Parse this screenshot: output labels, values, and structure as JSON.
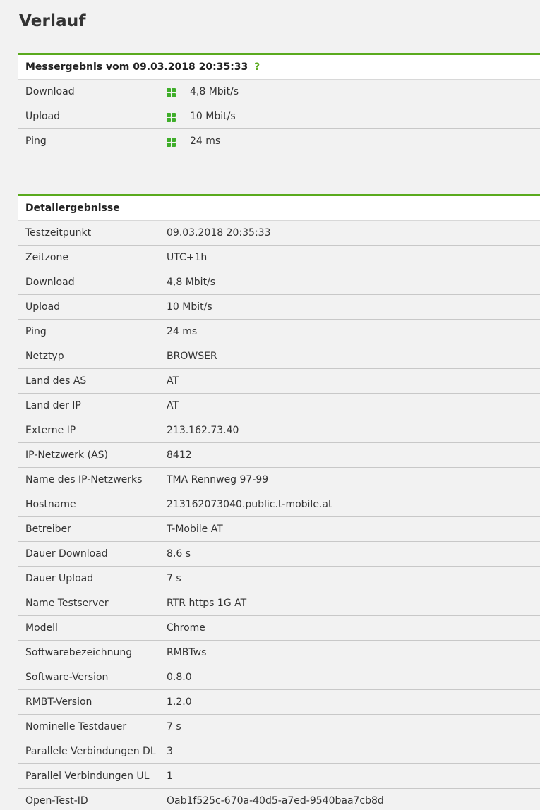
{
  "page": {
    "title": "Verlauf"
  },
  "result": {
    "header": "Messergebnis vom 09.03.2018 20:35:33",
    "help": "?",
    "quality_color": "#3fae2a",
    "rows": [
      {
        "label": "Download",
        "value": "4,8 Mbit/s",
        "icon": "quality-good-icon"
      },
      {
        "label": "Upload",
        "value": "10 Mbit/s",
        "icon": "quality-good-icon"
      },
      {
        "label": "Ping",
        "value": "24 ms",
        "icon": "quality-good-icon"
      }
    ]
  },
  "details": {
    "header": "Detailergebnisse",
    "rows": [
      {
        "label": "Testzeitpunkt",
        "value": "09.03.2018 20:35:33"
      },
      {
        "label": "Zeitzone",
        "value": "UTC+1h"
      },
      {
        "label": "Download",
        "value": "4,8 Mbit/s"
      },
      {
        "label": "Upload",
        "value": "10 Mbit/s"
      },
      {
        "label": "Ping",
        "value": "24 ms"
      },
      {
        "label": "Netztyp",
        "value": "BROWSER"
      },
      {
        "label": "Land des AS",
        "value": "AT"
      },
      {
        "label": "Land der IP",
        "value": "AT"
      },
      {
        "label": "Externe IP",
        "value": "213.162.73.40"
      },
      {
        "label": "IP-Netzwerk (AS)",
        "value": "8412"
      },
      {
        "label": "Name des IP-Netzwerks",
        "value": "TMA Rennweg 97-99"
      },
      {
        "label": "Hostname",
        "value": "213162073040.public.t-mobile.at"
      },
      {
        "label": "Betreiber",
        "value": "T-Mobile AT"
      },
      {
        "label": "Dauer Download",
        "value": "8,6 s"
      },
      {
        "label": "Dauer Upload",
        "value": "7 s"
      },
      {
        "label": "Name Testserver",
        "value": "RTR https 1G AT"
      },
      {
        "label": "Modell",
        "value": "Chrome"
      },
      {
        "label": "Softwarebezeichnung",
        "value": "RMBTws"
      },
      {
        "label": "Software-Version",
        "value": "0.8.0"
      },
      {
        "label": "RMBT-Version",
        "value": "1.2.0"
      },
      {
        "label": "Nominelle Testdauer",
        "value": "7 s"
      },
      {
        "label": "Parallele Verbindungen DL",
        "value": "3"
      },
      {
        "label": "Parallel Verbindungen UL",
        "value": "1"
      },
      {
        "label": "Open-Test-ID",
        "value": "Oab1f525c-670a-40d5-a7ed-9540baa7cb8d"
      }
    ]
  }
}
